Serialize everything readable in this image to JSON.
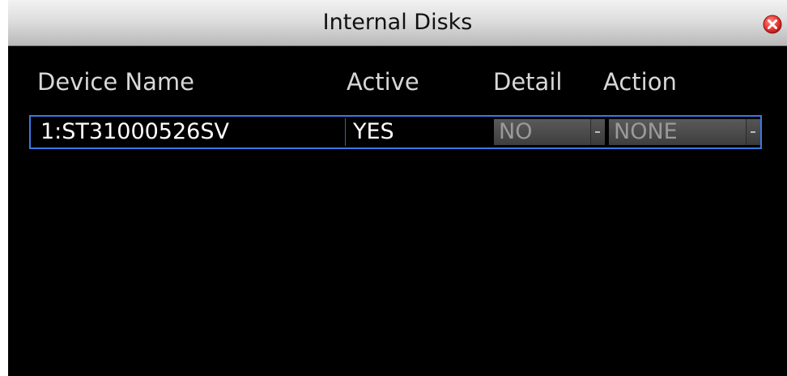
{
  "dialog": {
    "title": "Internal Disks",
    "close_icon": "close-icon",
    "close_color": "#e53935"
  },
  "table": {
    "columns": [
      "Device Name",
      "Active",
      "Detail",
      "Action"
    ],
    "rows": [
      {
        "device_name": "1:ST31000526SV",
        "active": "YES",
        "detail": "NO",
        "action": "NONE"
      }
    ]
  },
  "colors": {
    "background": "#000000",
    "selection_border": "#3a78e6"
  }
}
